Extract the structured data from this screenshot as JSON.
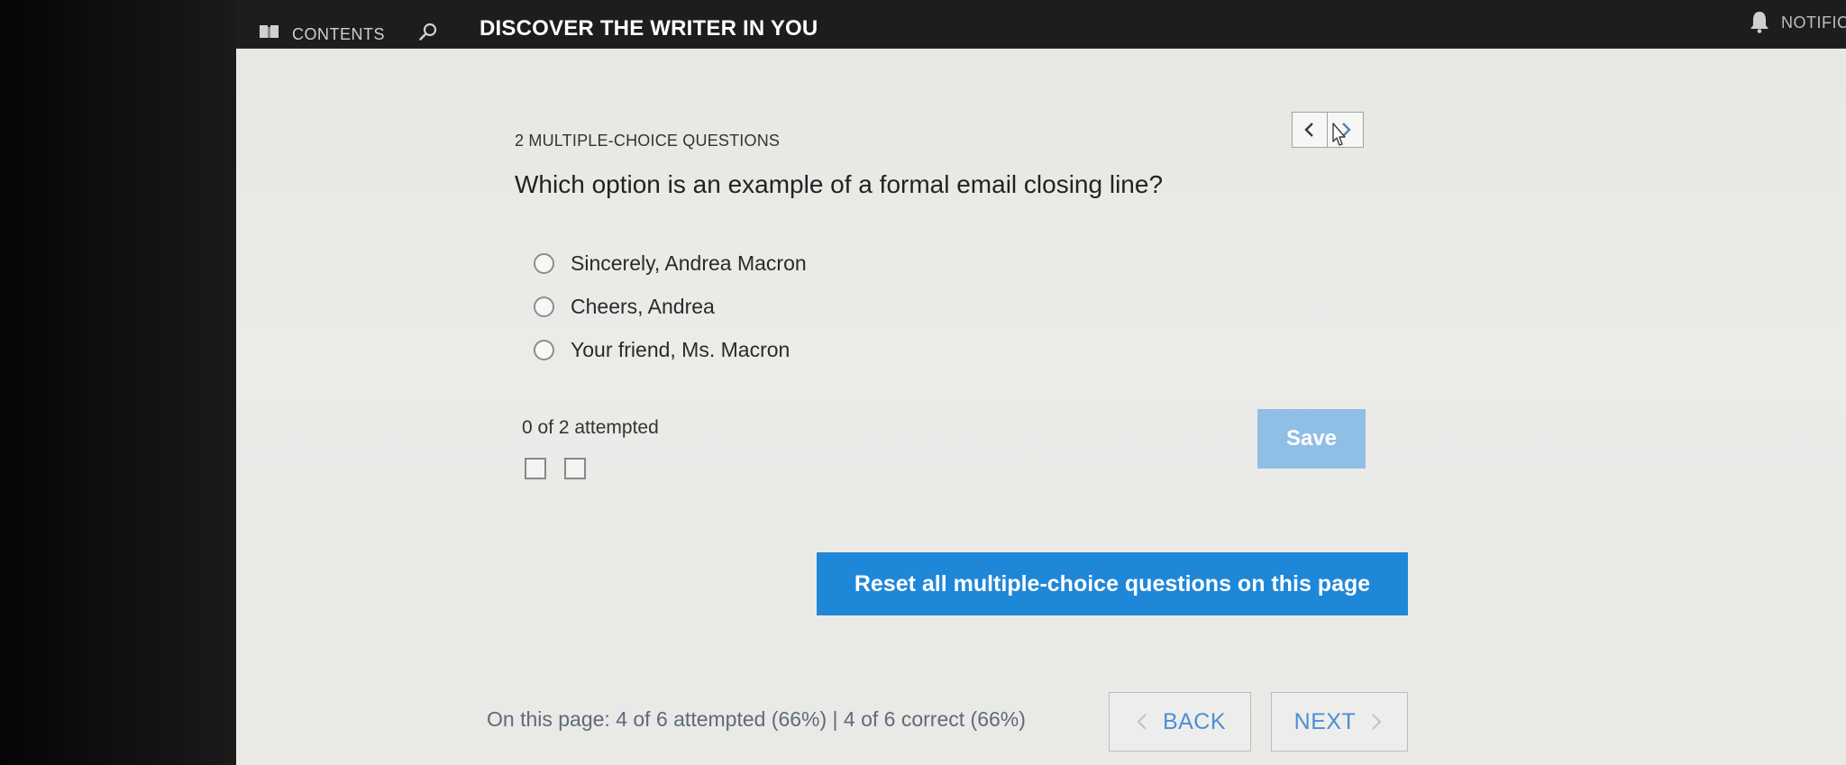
{
  "topbar": {
    "contents_label": "CONTENTS",
    "course_title": "DISCOVER THE WRITER IN YOU",
    "notifications_label": "NOTIFICA",
    "icons": {
      "contents": "book-icon",
      "search": "search-icon",
      "notifications": "bell-icon"
    }
  },
  "question_block": {
    "section_label": "2 MULTIPLE-CHOICE QUESTIONS",
    "question": "Which option is an example of a formal email closing line?",
    "options": [
      {
        "label": "Sincerely, Andrea Macron",
        "selected": false
      },
      {
        "label": "Cheers, Andrea",
        "selected": false
      },
      {
        "label": "Your friend, Ms. Macron",
        "selected": false
      }
    ],
    "attempt_status": "0 of 2 attempted",
    "progress_boxes": 2,
    "save_label": "Save"
  },
  "actions": {
    "reset_label": "Reset all multiple-choice questions on this page"
  },
  "footer": {
    "page_stats": "On this page: 4 of 6 attempted (66%) | 4 of 6 correct (66%)",
    "back_label": "BACK",
    "next_label": "NEXT"
  },
  "colors": {
    "topbar_bg": "#1d1d1f",
    "primary_button": "#1f87d8",
    "save_button_disabled": "#90bfe6",
    "nav_text": "#4d8ed6"
  }
}
